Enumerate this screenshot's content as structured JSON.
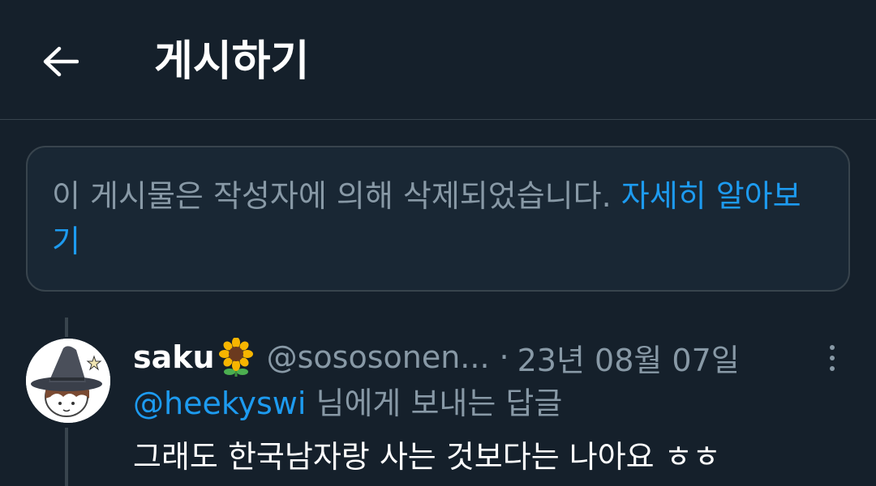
{
  "header": {
    "title": "게시하기",
    "back_icon": "arrow-left-icon"
  },
  "notice": {
    "text": "이 게시물은 작성자에 의해 삭제되었습니다. ",
    "link_label": "자세히 알아보기"
  },
  "reply": {
    "display_name": "saku",
    "name_emoji": "sunflower-icon",
    "handle": "@sososonen...",
    "separator": "·",
    "date": "23년 08월 07일",
    "reply_to_mention": "@heekyswi",
    "reply_to_suffix": " 님에게 보내는 답글",
    "text": "그래도 한국남자랑 사는 것보다는 나아요 ㅎㅎ",
    "more_icon": "more-vertical-icon"
  },
  "colors": {
    "background": "#15202b",
    "border": "#38444d",
    "secondary_text": "#8899a6",
    "link": "#1d9bf0"
  }
}
